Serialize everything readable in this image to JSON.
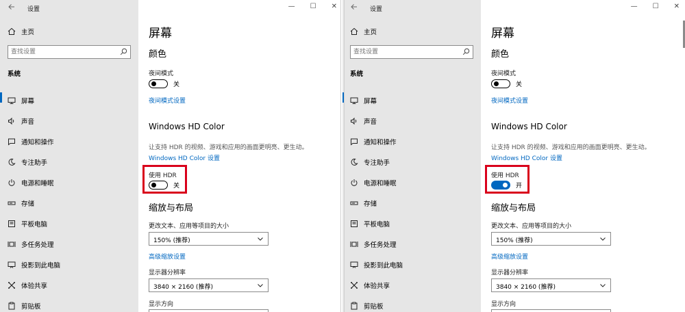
{
  "panes": [
    {
      "app_title": "设置",
      "home_label": "主页",
      "search_placeholder": "查找设置",
      "section_label": "系统",
      "nav": [
        {
          "label": "屏幕",
          "icon": "monitor-icon",
          "active": true
        },
        {
          "label": "声音",
          "icon": "speaker-icon",
          "active": false
        },
        {
          "label": "通知和操作",
          "icon": "notification-icon",
          "active": false
        },
        {
          "label": "专注助手",
          "icon": "moon-icon",
          "active": false
        },
        {
          "label": "电源和睡眠",
          "icon": "power-icon",
          "active": false
        },
        {
          "label": "存储",
          "icon": "storage-icon",
          "active": false
        },
        {
          "label": "平板电脑",
          "icon": "tablet-icon",
          "active": false
        },
        {
          "label": "多任务处理",
          "icon": "multitask-icon",
          "active": false
        },
        {
          "label": "投影到此电脑",
          "icon": "project-icon",
          "active": false
        },
        {
          "label": "体验共享",
          "icon": "share-icon",
          "active": false
        },
        {
          "label": "剪贴板",
          "icon": "clipboard-icon",
          "active": false
        }
      ],
      "content": {
        "page_title": "屏幕",
        "color_heading": "颜色",
        "night_light_label": "夜间模式",
        "night_light_state": "关",
        "night_light_on": false,
        "night_light_link": "夜间模式设置",
        "hdr_heading": "Windows HD Color",
        "hdr_desc": "让支持 HDR 的视频、游戏和应用的画面更明亮、更生动。",
        "hdr_link": "Windows HD Color 设置",
        "use_hdr_label": "使用 HDR",
        "use_hdr_state": "关",
        "use_hdr_on": false,
        "scale_heading": "缩放与布局",
        "scale_label": "更改文本、应用等项目的大小",
        "scale_value": "150% (推荐)",
        "advanced_scale_link": "高级缩放设置",
        "resolution_label": "显示器分辨率",
        "resolution_value": "3840 × 2160 (推荐)",
        "orientation_label": "显示方向"
      }
    },
    {
      "app_title": "设置",
      "home_label": "主页",
      "search_placeholder": "查找设置",
      "section_label": "系统",
      "nav": [
        {
          "label": "屏幕",
          "icon": "monitor-icon",
          "active": true
        },
        {
          "label": "声音",
          "icon": "speaker-icon",
          "active": false
        },
        {
          "label": "通知和操作",
          "icon": "notification-icon",
          "active": false
        },
        {
          "label": "专注助手",
          "icon": "moon-icon",
          "active": false
        },
        {
          "label": "电源和睡眠",
          "icon": "power-icon",
          "active": false
        },
        {
          "label": "存储",
          "icon": "storage-icon",
          "active": false
        },
        {
          "label": "平板电脑",
          "icon": "tablet-icon",
          "active": false
        },
        {
          "label": "多任务处理",
          "icon": "multitask-icon",
          "active": false
        },
        {
          "label": "投影到此电脑",
          "icon": "project-icon",
          "active": false
        },
        {
          "label": "体验共享",
          "icon": "share-icon",
          "active": false
        },
        {
          "label": "剪贴板",
          "icon": "clipboard-icon",
          "active": false
        }
      ],
      "content": {
        "page_title": "屏幕",
        "color_heading": "颜色",
        "night_light_label": "夜间模式",
        "night_light_state": "关",
        "night_light_on": false,
        "night_light_link": "夜间模式设置",
        "hdr_heading": "Windows HD Color",
        "hdr_desc": "让支持 HDR 的视频、游戏和应用的画面更明亮、更生动。",
        "hdr_link": "Windows HD Color 设置",
        "use_hdr_label": "使用 HDR",
        "use_hdr_state": "开",
        "use_hdr_on": true,
        "scale_heading": "缩放与布局",
        "scale_label": "更改文本、应用等项目的大小",
        "scale_value": "150% (推荐)",
        "advanced_scale_link": "高级缩放设置",
        "resolution_label": "显示器分辨率",
        "resolution_value": "3840 × 2160 (推荐)",
        "orientation_label": "显示方向"
      }
    }
  ],
  "colors": {
    "accent": "#0067c0",
    "highlight": "#d9001b",
    "sidebar_bg": "#e6e6e6"
  }
}
